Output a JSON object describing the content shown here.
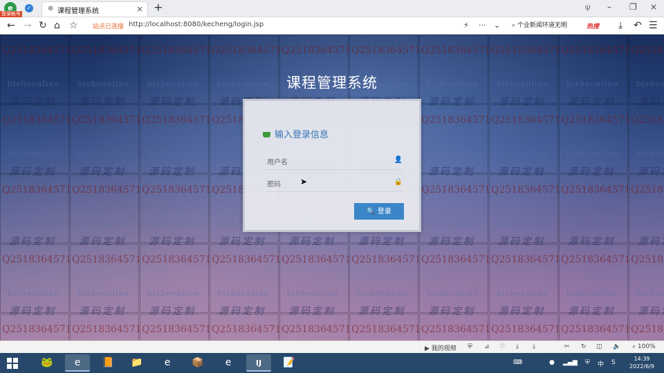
{
  "browser": {
    "logo_glyph": "e",
    "login_badge": "登录帐号",
    "tab": {
      "title": "课程管理系统",
      "close": "×"
    },
    "new_tab": "+",
    "window_controls": {
      "pin": "⍦",
      "minimize": "–",
      "restore": "❐",
      "close": "×"
    },
    "nav": {
      "back": "←",
      "forward": "→",
      "reload": "↻",
      "home": "⌂",
      "favorite": "☆"
    },
    "security_label": "站点已连接",
    "url": {
      "host": "http://localhost",
      "rest": ":8080/kecheng/login.jsp"
    },
    "right_tools": {
      "flash": "⚡",
      "more": "···",
      "dropdown": "⌄"
    },
    "search_text": "个业新闻环道无明",
    "hot_label": "热搜",
    "menu_icons": {
      "download": "⤓",
      "undo": "↶",
      "menu": "☰"
    }
  },
  "watermark": {
    "qq": "Q2518364571",
    "english": "bisheonline",
    "chinese": "源码定制"
  },
  "page": {
    "system_title": "课程管理系统",
    "panel_heading": "输入登录信息",
    "username_placeholder": "用户名",
    "password_placeholder": "密码",
    "login_button": "🔍 登录"
  },
  "statusbar": {
    "video": "我的视频",
    "zoom": "100%"
  },
  "taskbar": {
    "time": "14:39",
    "date": "2022/6/9",
    "ime": "中",
    "apps": [
      "🐸",
      "e",
      "📙",
      "📁",
      "e",
      "📦",
      "e",
      "IJ",
      "📝"
    ]
  },
  "colors": {
    "accent": "#3a86c8",
    "heading": "#3b74b4",
    "taskbar": "#27486a"
  }
}
